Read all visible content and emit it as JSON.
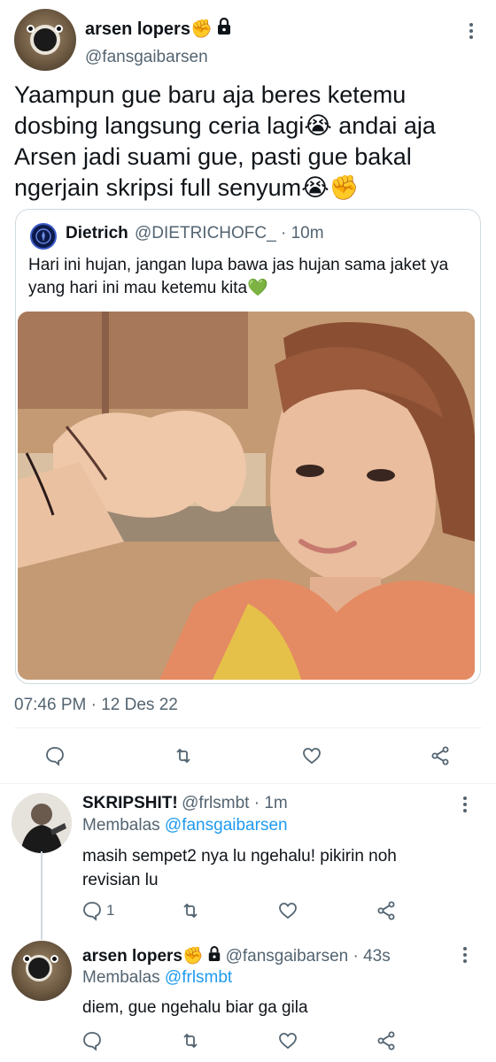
{
  "main_tweet": {
    "author_name": "arsen lopers✊",
    "author_handle": "@fansgaibarsen",
    "text": "Yaampun gue baru aja beres ketemu dosbing langsung ceria lagi😭 andai aja Arsen jadi suami gue, pasti gue bakal ngerjain skripsi full senyum😭✊",
    "timestamp": "07:46 PM · 12 Des 22"
  },
  "quoted_tweet": {
    "author_name": "Dietrich",
    "author_handle": "@DIETRICHOFC_ · 10m",
    "text": "Hari ini hujan, jangan lupa bawa jas hujan sama jaket ya yang hari ini mau ketemu kita💚"
  },
  "replies": [
    {
      "author_name": "SKRIPSHIT!",
      "meta": "@frlsmbt · 1m",
      "replying_to_prefix": "Membalas ",
      "replying_to": "@fansgaibarsen",
      "text": "masih sempet2 nya lu ngehalu! pikirin noh revisian lu",
      "reply_count": "1"
    },
    {
      "author_name": "arsen lopers✊",
      "meta": "@fansgaibarsen · 43s",
      "replying_to_prefix": "Membalas ",
      "replying_to": "@frlsmbt",
      "text": "diem, gue ngehalu biar ga gila"
    }
  ],
  "colors": {
    "text": "#0f1419",
    "secondary": "#536471",
    "link": "#1d9bf0",
    "border": "#cfd9de"
  },
  "icons": [
    "more-icon",
    "lock-icon",
    "reply-icon",
    "retweet-icon",
    "like-icon",
    "share-icon"
  ]
}
